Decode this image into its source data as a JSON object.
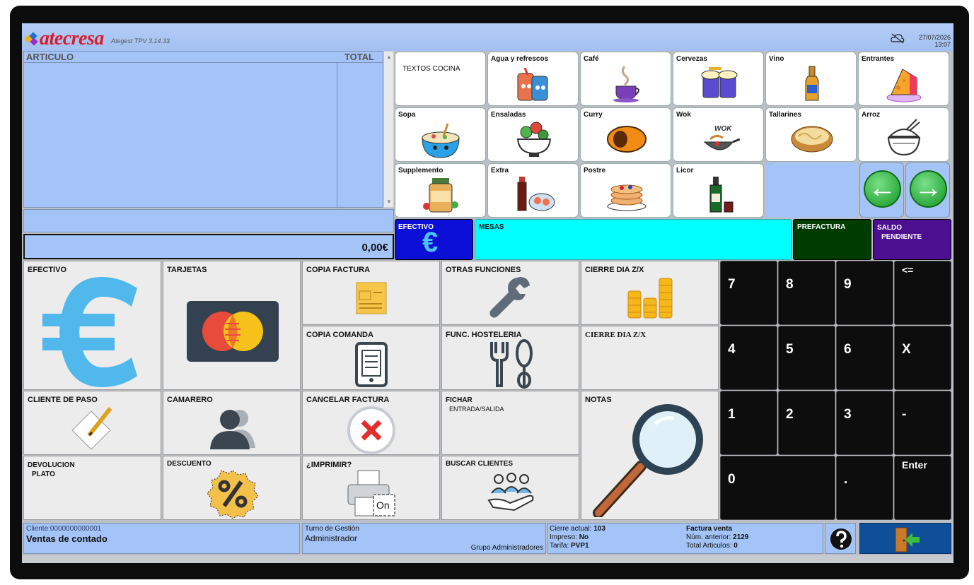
{
  "app": {
    "brand": "atecresa",
    "version": "Ategest TPV 3.14.33"
  },
  "clock": {
    "date": "27/07/2026",
    "time": "13:07"
  },
  "ticket": {
    "col_article": "ARTICULO",
    "col_total": "TOTAL",
    "total": "0,00€"
  },
  "families": [
    {
      "label": "TEXTOS COCINA",
      "icon": "text-note"
    },
    {
      "label": "Agua y refrescos",
      "icon": "soda-cans-icon"
    },
    {
      "label": "Café",
      "icon": "coffee-cup-icon"
    },
    {
      "label": "Cervezas",
      "icon": "beer-mugs-icon"
    },
    {
      "label": "Vino",
      "icon": "wine-bottle-icon"
    },
    {
      "label": "Entrantes",
      "icon": "cheese-icon"
    },
    {
      "label": "Sopa",
      "icon": "soup-bowl-icon"
    },
    {
      "label": "Ensaladas",
      "icon": "salad-bowl-icon"
    },
    {
      "label": "Curry",
      "icon": "curry-plate-icon"
    },
    {
      "label": "Wok",
      "icon": "wok-icon"
    },
    {
      "label": "Tallarines",
      "icon": "noodles-icon"
    },
    {
      "label": "Arroz",
      "icon": "rice-bowl-icon"
    },
    {
      "label": "Supplemento",
      "icon": "supplement-jar-icon"
    },
    {
      "label": "Extra",
      "icon": "sushi-icon"
    },
    {
      "label": "Postre",
      "icon": "pancakes-icon"
    },
    {
      "label": "Licor",
      "icon": "liquor-bottle-icon"
    }
  ],
  "actions": {
    "efectivo": "EFECTIVO",
    "mesas": "MESAS",
    "prefactura": "PREFACTURA",
    "saldo_1": "SALDO",
    "saldo_2": "PENDIENTE"
  },
  "functions": {
    "efectivo": "EFECTIVO",
    "tarjetas": "TARJETAS",
    "copia_factura": "COPIA FACTURA",
    "otras_funciones": "OTRAS FUNCIONES",
    "cierre_1": "CIERRE DIA Z/X",
    "copia_comanda": "COPIA COMANDA",
    "func_hosteleria": "FUNC. HOSTELERIA",
    "cierre_2": "CIERRE DIA Z/X",
    "cliente_paso": "CLIENTE DE PASO",
    "camarero": "CAMARERO",
    "cancelar_factura": "CANCELAR FACTURA",
    "fichar": "FICHAR",
    "fichar_sub": "ENTRADA/SALIDA",
    "notas": "NOTAS",
    "devolucion_1": "DEVOLUCION",
    "devolucion_2": "PLATO",
    "descuento": "DESCUENTO",
    "imprimir": "¿IMPRIMIR?",
    "imprimir_state": "On",
    "buscar_clientes": "BUSCAR CLIENTES"
  },
  "keypad": {
    "k7": "7",
    "k8": "8",
    "k9": "9",
    "back": "<=",
    "k4": "4",
    "k5": "5",
    "k6": "6",
    "x": "X",
    "k1": "1",
    "k2": "2",
    "k3": "3",
    "minus": "-",
    "k0": "0",
    "dot": ".",
    "enter": "Enter"
  },
  "status": {
    "client": "Cliente:0000000000001",
    "client_name": "Ventas de contado",
    "turno_label": "Turno de Gestión",
    "turno_user": "Administrador",
    "turno_group": "Grupo Administradores",
    "cierre_label": "Cierre actual:",
    "cierre_val": "103",
    "impreso_label": "Impreso:",
    "impreso_val": "No",
    "tarifa_label": "Tarifa:",
    "tarifa_val": "PVP1",
    "factura_title": "Factura venta",
    "num_anterior_label": "Núm. anterior:",
    "num_anterior_val": "2129",
    "total_articulos_label": "Total Articulos:",
    "total_articulos_val": "0"
  },
  "colors": {
    "accent_blue": "#a4c4f7",
    "cash": "#0c10d6",
    "mesas": "#00ffff",
    "prefactura": "#003c00",
    "saldo": "#4b0f8f"
  }
}
